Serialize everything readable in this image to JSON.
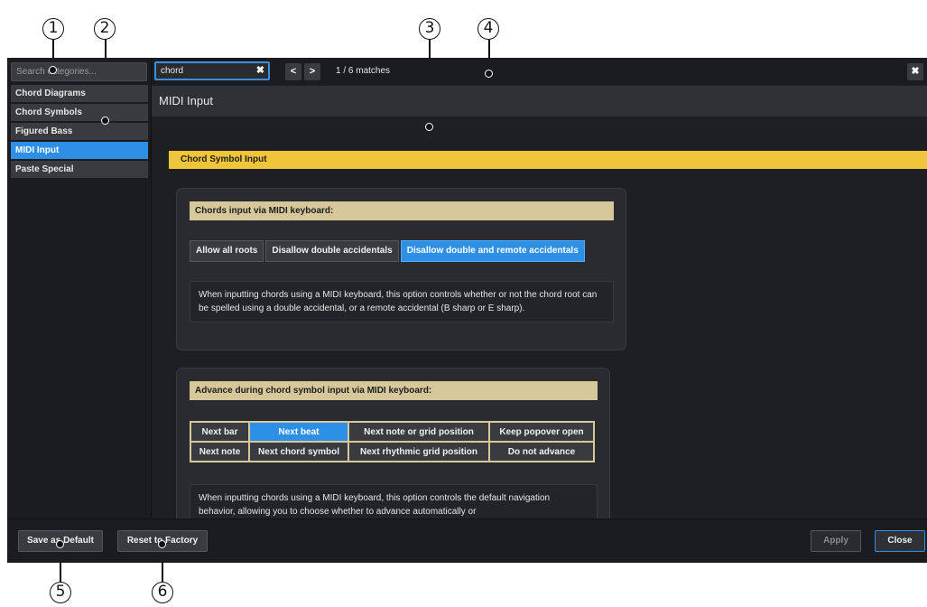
{
  "callouts": [
    "1",
    "2",
    "3",
    "4",
    "5",
    "6"
  ],
  "sidebar": {
    "search_placeholder": "Search categories...",
    "items": [
      {
        "label": "Chord Diagrams"
      },
      {
        "label": "Chord Symbols"
      },
      {
        "label": "Figured Bass"
      },
      {
        "label": "MIDI Input",
        "selected": true
      },
      {
        "label": "Paste Special"
      }
    ]
  },
  "topbar": {
    "search_value": "chord",
    "clear_glyph": "✖",
    "prev_glyph": "<",
    "next_glyph": ">",
    "match_count": "1 / 6 matches",
    "close_glyph": "✖"
  },
  "page": {
    "title": "MIDI Input",
    "section_title": "Chord Symbol Input",
    "option1": {
      "label": "Chords input via MIDI keyboard:",
      "choices": [
        "Allow all roots",
        "Disallow double accidentals",
        "Disallow double and remote accidentals"
      ],
      "selected_index": 2,
      "description": "When inputting chords using a MIDI keyboard, this option controls whether or not the chord root can be spelled using a double accidental, or a remote accidental (B sharp or E sharp)."
    },
    "option2": {
      "label": "Advance during chord symbol input via MIDI keyboard:",
      "choices_row1": [
        "Next bar",
        "Next beat",
        "Next note or grid position",
        "Keep popover open"
      ],
      "choices_row2": [
        "Next note",
        "Next chord symbol",
        "Next rhythmic grid position",
        "Do not advance"
      ],
      "selected": "Next beat",
      "description": "When inputting chords using a MIDI keyboard, this option controls the default navigation behavior, allowing you to choose whether to advance automatically or"
    }
  },
  "bottombar": {
    "save_default": "Save as Default",
    "reset_factory": "Reset to Factory",
    "apply": "Apply",
    "close": "Close"
  },
  "colors": {
    "accent": "#2d8fe6",
    "section_banner": "#f0c53a",
    "option_label": "#d6c89a",
    "background": "#1e1f22"
  }
}
